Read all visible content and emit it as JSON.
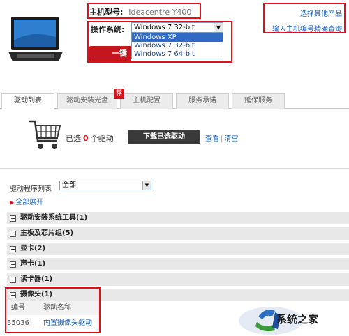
{
  "product": {
    "model_label": "主机型号:",
    "model_value": "Ideacentre Y400"
  },
  "os": {
    "label": "操作系统:",
    "selected": "Windows 7 32-bit",
    "options": [
      "Windows XP",
      "Windows 7 32-bit",
      "Windows 7 64-bit"
    ],
    "highlighted_index": 0
  },
  "action_button": "一键",
  "top_links": {
    "choose_other": "选择其他产品",
    "enter_serial": "输入主机编号精确查询"
  },
  "tabs": [
    {
      "label": "驱动列表"
    },
    {
      "label": "驱动安装光盘"
    },
    {
      "label": "主机配置"
    },
    {
      "label": "服务承诺"
    },
    {
      "label": "延保服务"
    }
  ],
  "tab_badge": "荐",
  "cart": {
    "prefix": "已选",
    "count": "0",
    "suffix": "个驱动",
    "download_button": "下载已选驱动",
    "view_link": "查看",
    "clear_link": "清空"
  },
  "driver_list": {
    "label": "驱动程序列表",
    "selected": "全部",
    "expand_all": "全部展开"
  },
  "categories": [
    {
      "label": "驱动安装系统工具(1)",
      "sign": "+"
    },
    {
      "label": "主板及芯片组(5)",
      "sign": "+"
    },
    {
      "label": "显卡(2)",
      "sign": "+"
    },
    {
      "label": "声卡(1)",
      "sign": "+"
    },
    {
      "label": "读卡器(1)",
      "sign": "+"
    },
    {
      "label": "摄像头(1)",
      "sign": "−"
    }
  ],
  "driver_table": {
    "headers": [
      "编号",
      "驱动名称"
    ],
    "rows": [
      {
        "id": "35036",
        "name": "内置摄像头驱动"
      }
    ]
  },
  "watermark": {
    "text": "系统之家"
  },
  "colors": {
    "highlight_red": "#e0101a",
    "link_blue": "#1a5fb4",
    "select_blue": "#316ac5"
  }
}
